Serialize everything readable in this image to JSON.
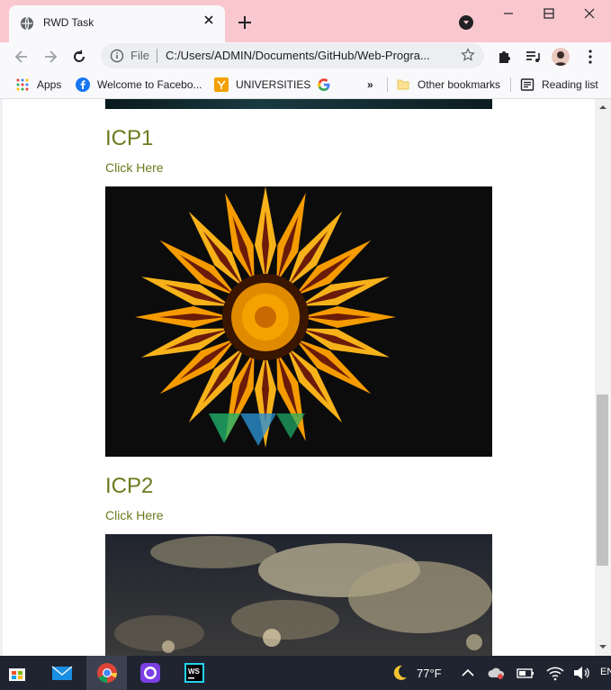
{
  "browser": {
    "tab_title": "RWD Task",
    "address_scheme": "File",
    "address_url": "C:/Users/ADMIN/Documents/GitHub/Web-Progra...",
    "bookmarks": [
      "Apps",
      "Welcome to Facebo...",
      "UNIVERSITIES",
      "»",
      "Other bookmarks",
      "Reading list"
    ]
  },
  "page": {
    "sections": [
      {
        "title": "ICP1",
        "link": "Click Here",
        "image": "sunflower-photo"
      },
      {
        "title": "ICP2",
        "link": "Click Here",
        "image": "clouds-photo"
      }
    ]
  },
  "taskbar": {
    "weather": "77°F",
    "lang": "EN"
  },
  "colors": {
    "accent_olive": "#6b7b1e",
    "titlebar": "#f9c8cf",
    "taskbar": "#1f2430"
  }
}
